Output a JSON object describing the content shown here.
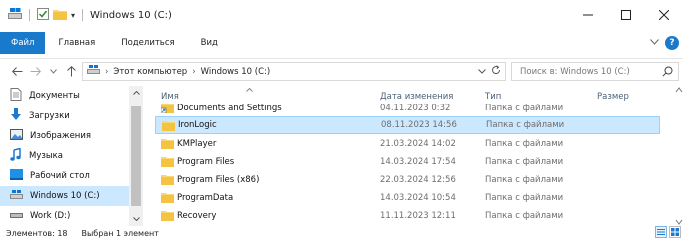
{
  "window": {
    "title": "Windows 10 (C:)",
    "qat_dropdown": "▾"
  },
  "ribbon": {
    "tabs": [
      "Файл",
      "Главная",
      "Поделиться",
      "Вид"
    ],
    "help": "?"
  },
  "address": {
    "path": [
      "Этот компьютер",
      "Windows 10 (C:)"
    ],
    "search_placeholder": "Поиск в: Windows 10 (C:)"
  },
  "nav": {
    "items": [
      {
        "label": "Документы",
        "icon": "documents-icon"
      },
      {
        "label": "Загрузки",
        "icon": "downloads-icon"
      },
      {
        "label": "Изображения",
        "icon": "pictures-icon"
      },
      {
        "label": "Музыка",
        "icon": "music-icon"
      },
      {
        "label": "Рабочий стол",
        "icon": "desktop-icon"
      },
      {
        "label": "Windows 10 (C:)",
        "icon": "drive-icon"
      },
      {
        "label": "Work (D:)",
        "icon": "drive-icon"
      }
    ],
    "selected_index": 5
  },
  "columns": {
    "name": "Имя",
    "date": "Дата изменения",
    "type": "Тип",
    "size": "Размер"
  },
  "files": [
    {
      "name": "Documents and Settings",
      "date": "04.11.2023 0:32",
      "type": "Папка с файлами",
      "shortcut": true
    },
    {
      "name": "IronLogic",
      "date": "08.11.2023 14:56",
      "type": "Папка с файлами"
    },
    {
      "name": "KMPlayer",
      "date": "21.03.2024 14:02",
      "type": "Папка с файлами"
    },
    {
      "name": "Program Files",
      "date": "14.03.2024 17:54",
      "type": "Папка с файлами"
    },
    {
      "name": "Program Files (x86)",
      "date": "22.03.2024 12:56",
      "type": "Папка с файлами"
    },
    {
      "name": "ProgramData",
      "date": "14.03.2024 10:54",
      "type": "Папка с файлами"
    },
    {
      "name": "Recovery",
      "date": "11.11.2023 12:11",
      "type": "Папка с файлами"
    }
  ],
  "selected_file_index": 1,
  "status": {
    "count": "Элементов: 18",
    "selection": "Выбран 1 элемент"
  },
  "colors": {
    "accent": "#1979ca",
    "selection": "#cce8ff",
    "folder": "#f8d775"
  }
}
